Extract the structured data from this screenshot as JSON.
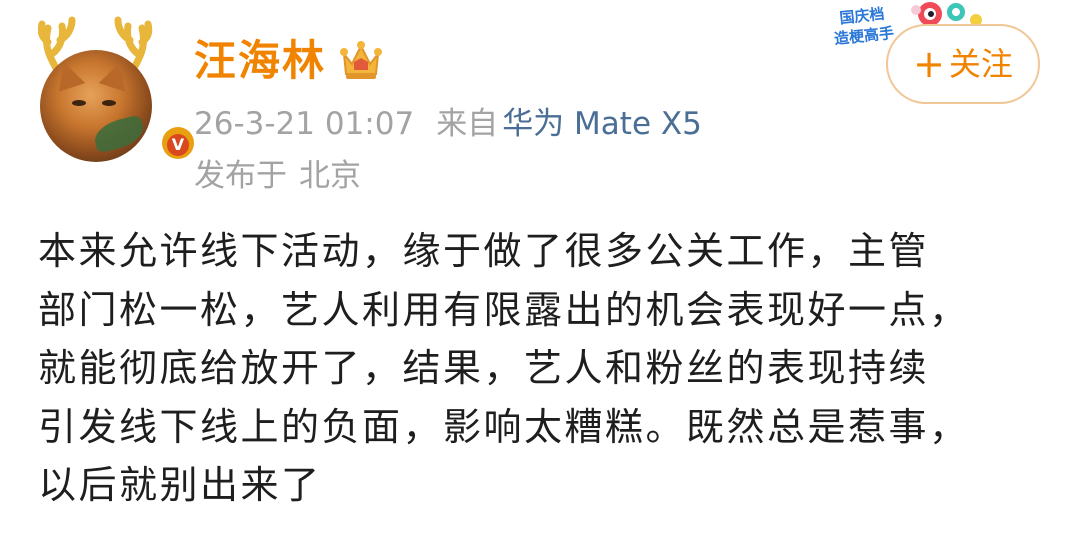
{
  "user": {
    "name": "汪海林",
    "crown_icon": "crown-icon",
    "verified_icon": "verified-v-icon",
    "verified_glyph": "V",
    "avatar_icon": "cat-avatar-with-antlers"
  },
  "meta": {
    "timestamp": "26-3-21 01:07",
    "from_label": "来自",
    "device": "华为 Mate X5",
    "location_label": "发布于",
    "location": "北京"
  },
  "badge": {
    "lines": [
      "国庆档",
      "造梗高手"
    ]
  },
  "follow": {
    "plus": "+",
    "label": "关注"
  },
  "post": {
    "lines": [
      "本来允许线下活动，缘于做了很多公关工作，主管",
      "部门松一松，艺人利用有限露出的机会表现好一点，",
      "就能彻底给放开了，结果，艺人和粉丝的表现持续",
      "引发线下线上的负面，影响太糟糕。既然总是惹事，",
      "以后就别出来了"
    ]
  },
  "colors": {
    "username": "#f08300",
    "meta": "#a3a3a3",
    "device": "#4a6e96",
    "body_text": "#1e1e1e",
    "follow_border": "#f0c694",
    "verified_bg": "#e8a010",
    "badge_text": "#2a78d8"
  }
}
